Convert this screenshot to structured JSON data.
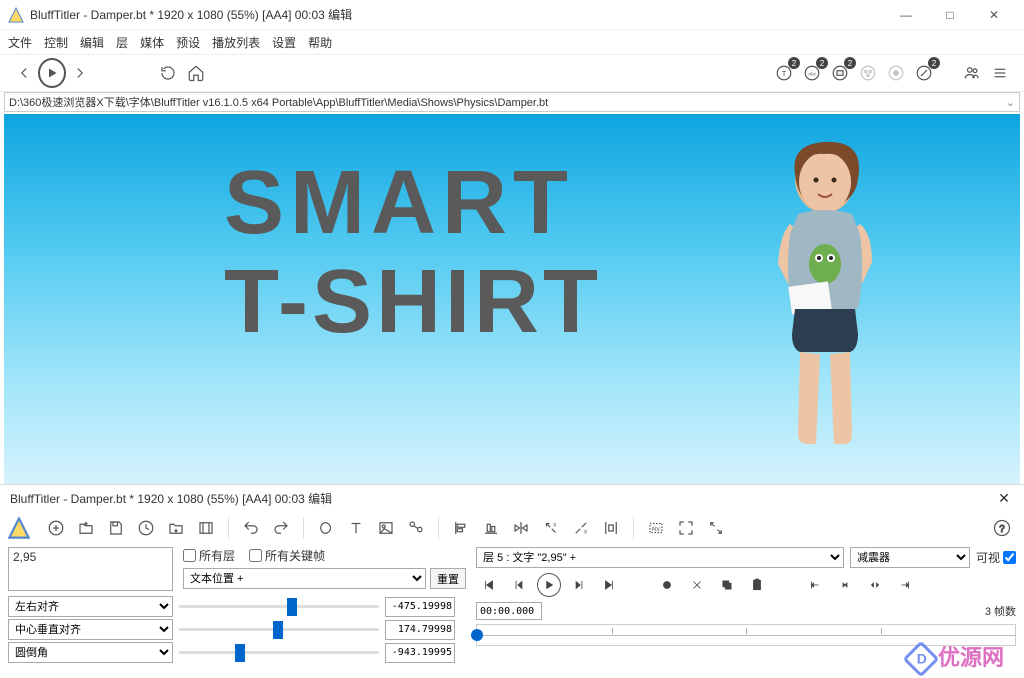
{
  "window": {
    "title": "BluffTitler - Damper.bt * 1920 x 1080 (55%) [AA4] 00:03 编辑"
  },
  "menu": [
    "文件",
    "控制",
    "编辑",
    "层",
    "媒体",
    "预设",
    "播放列表",
    "设置",
    "帮助"
  ],
  "badges": [
    "2",
    "2",
    "2",
    "2"
  ],
  "path": "D:\\360极速浏览器X下载\\字体\\BluffTitler v16.1.0.5 x64 Portable\\App\\BluffTitler\\Media\\Shows\\Physics\\Damper.bt",
  "preview": {
    "line1": "SMART",
    "line2": "T-SHIRT"
  },
  "panel": {
    "title": "BluffTitler - Damper.bt * 1920 x 1080 (55%) [AA4] 00:03 编辑",
    "text_value": "2,95",
    "all_layers": "所有层",
    "all_keys": "所有关键帧",
    "prop_select": "文本位置 +",
    "reset": "重置",
    "layer_select": "层 5 : 文字 \"2,95\" +",
    "effect_select": "减震器",
    "visible": "可视",
    "align1": "左右对齐",
    "align2": "中心垂直对齐",
    "align3": "圆倒角",
    "val1": "-475.19998",
    "val2": "174.79998",
    "val3": "-943.19995",
    "timecode": "00:00.000",
    "frames": "3 帧数"
  },
  "watermark": "优源网"
}
